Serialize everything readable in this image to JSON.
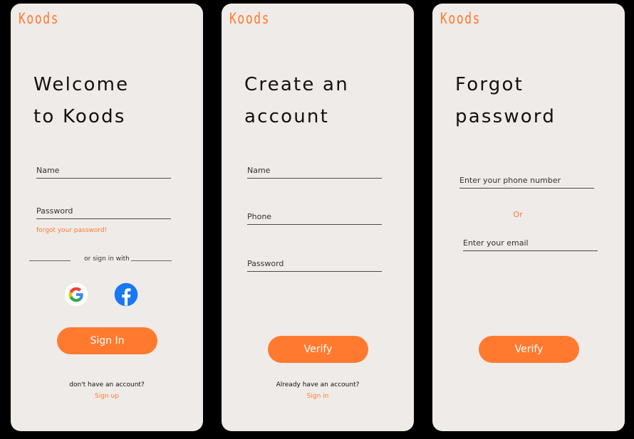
{
  "brand": {
    "logo": "Koods",
    "accent_color": "#ff7a2f",
    "card_color": "#eeebe9"
  },
  "signin": {
    "title_line1": "Welcome",
    "title_line2": "to Koods",
    "name_placeholder": "Name",
    "password_placeholder": "Password",
    "forgot_link": "forgot your password!",
    "divider_text": "or sign in with",
    "social": [
      {
        "name": "Google",
        "icon": "google-icon"
      },
      {
        "name": "Facebook",
        "icon": "facebook-icon"
      }
    ],
    "button": "Sign In",
    "prompt": "don't have an account?",
    "link": "Sign up"
  },
  "signup": {
    "title_line1": "Create an",
    "title_line2": "account",
    "name_placeholder": "Name",
    "phone_placeholder": "Phone",
    "password_placeholder": "Password",
    "button": "Verify",
    "prompt": "Already have an account?",
    "link": "Sign in"
  },
  "forgot": {
    "title_line1": "Forgot",
    "title_line2": "password",
    "phone_placeholder": "Enter your phone number",
    "or_text": "Or",
    "email_placeholder": "Enter your email",
    "button": "Verify"
  }
}
